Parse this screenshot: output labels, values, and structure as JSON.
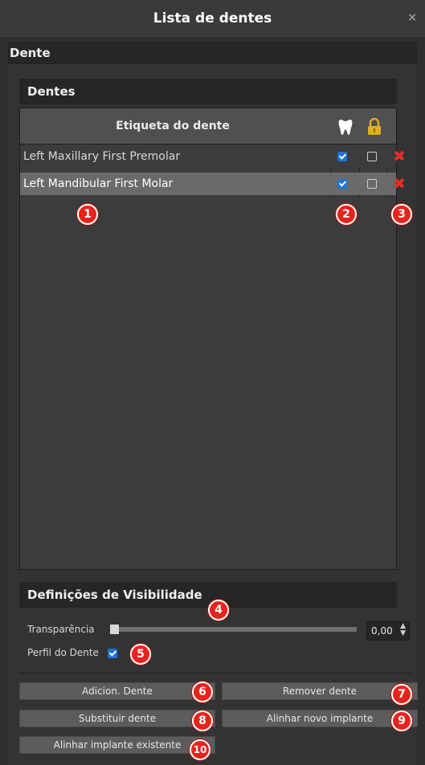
{
  "window": {
    "title": "Lista de dentes",
    "close_glyph": "×"
  },
  "section": {
    "title": "Dente"
  },
  "teeth_group": {
    "title": "Dentes",
    "column_label": "Etiqueta do dente",
    "rows": [
      {
        "label": "Left Maxillary First Premolar",
        "visible": true,
        "locked": false,
        "delete_glyph": "✖"
      },
      {
        "label": "Left Mandibular First Molar",
        "visible": true,
        "locked": false,
        "delete_glyph": "✖"
      }
    ]
  },
  "visibility": {
    "title": "Definições de Visibilidade",
    "transparency_label": "Transparência",
    "transparency_value": "0,00",
    "transparency_fraction": 0.0,
    "profile_label": "Perfil do Dente",
    "profile_checked": true
  },
  "buttons": {
    "add_tooth": "Adicion. Dente",
    "remove_tooth": "Remover dente",
    "replace_tooth": "Substituir dente",
    "align_new_implant": "Alinhar novo implante",
    "align_existing_implant": "Alinhar implante existente"
  },
  "callouts": [
    "1",
    "2",
    "3",
    "4",
    "5",
    "6",
    "7",
    "8",
    "9",
    "10"
  ],
  "colors": {
    "accent_checkbox": "#1e73d8",
    "delete_red": "#e0302a",
    "badge_red": "#e8231c",
    "lock_gold": "#e0b020"
  },
  "icons": {
    "header_visibility": "tooth-icon",
    "header_lock": "lock-icon"
  }
}
